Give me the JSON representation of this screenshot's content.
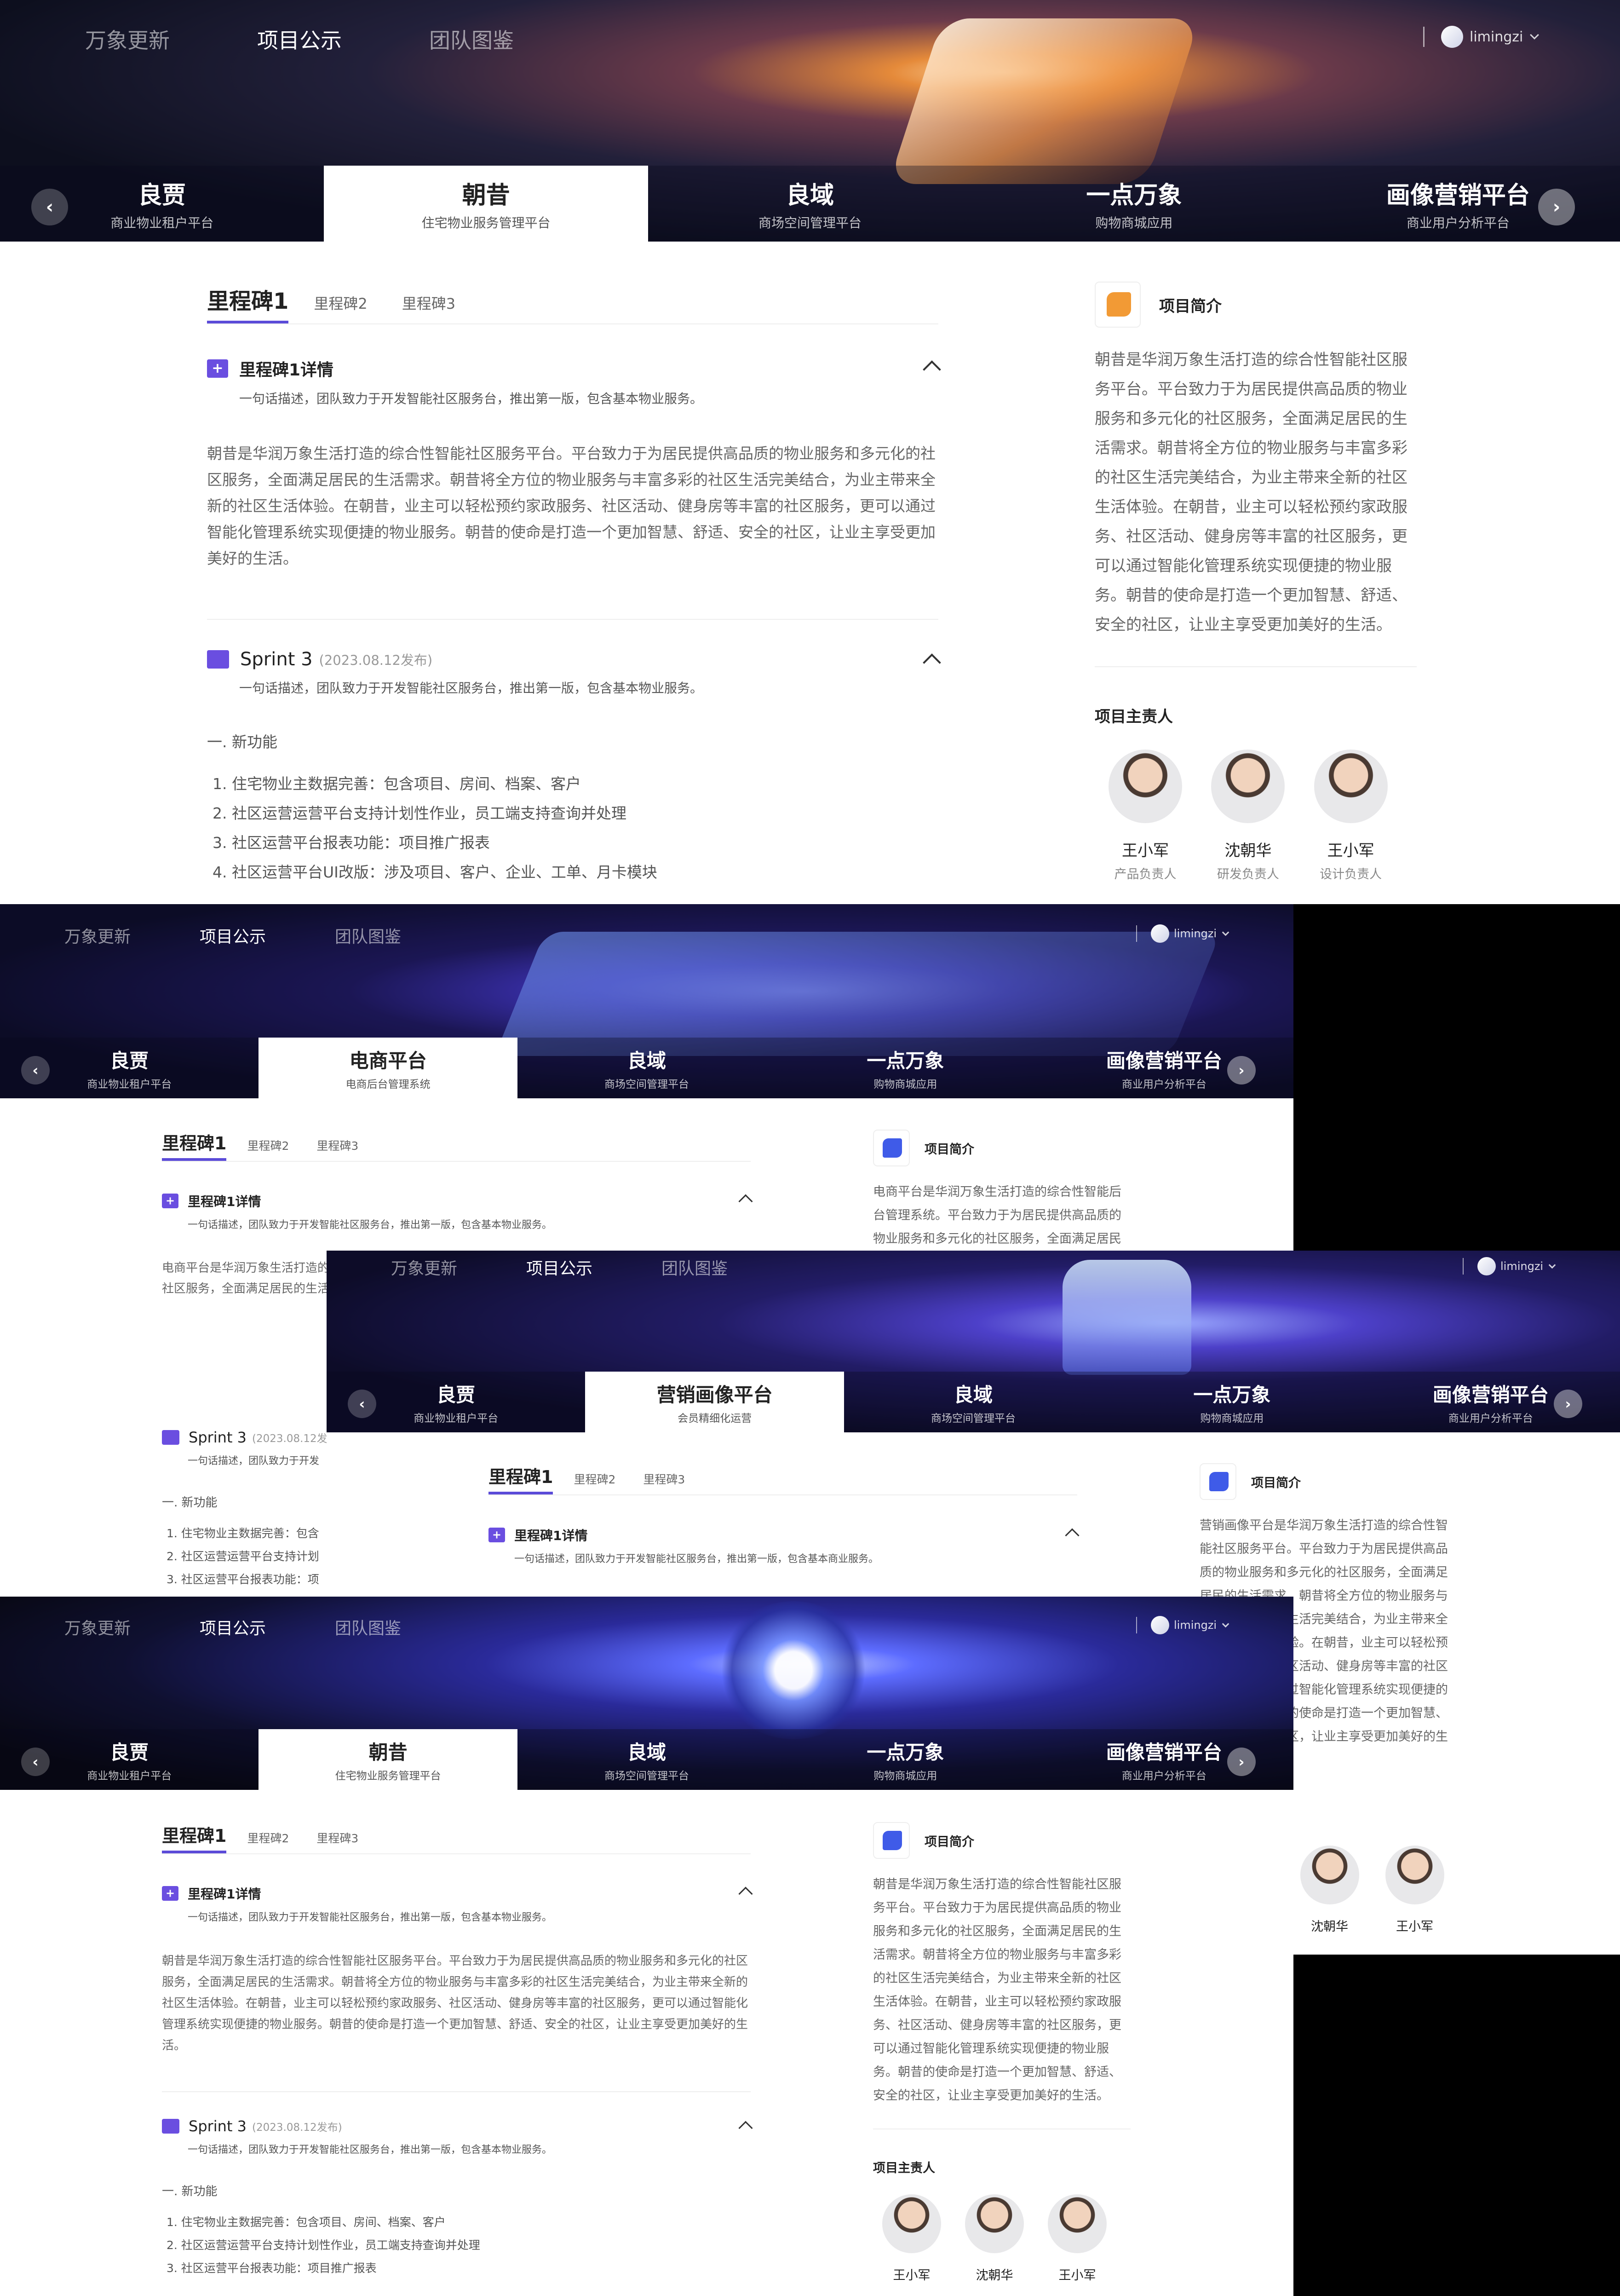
{
  "colors": {
    "accent": "#5b4bd8",
    "section_icon": "#6a4ee0",
    "logo_orange": "#f29a35",
    "logo_blue": "#3f5be8"
  },
  "header": {
    "nav": [
      "万象更新",
      "项目公示",
      "团队图鉴"
    ],
    "active_nav": "项目公示",
    "username": "limingzi",
    "prev_icon": "chevron-left-icon",
    "next_icon": "chevron-right-icon"
  },
  "shots": [
    {
      "tabs": [
        {
          "title": "良贾",
          "subtitle": "商业物业租户平台"
        },
        {
          "title": "朝昔",
          "subtitle": "住宅物业服务管理平台"
        },
        {
          "title": "良域",
          "subtitle": "商场空间管理平台"
        },
        {
          "title": "一点万象",
          "subtitle": "购物商城应用"
        },
        {
          "title": "画像营销平台",
          "subtitle": "商业用户分析平台"
        }
      ],
      "active_tab": "朝昔",
      "milestones": [
        "里程碑1",
        "里程碑2",
        "里程碑3"
      ],
      "detail": {
        "title": "里程碑1详情",
        "desc": "一句话描述，团队致力于开发智能社区服务台，推出第一版，包含基本物业服务。"
      },
      "body": "朝昔是华润万象生活打造的综合性智能社区服务平台。平台致力于为居民提供高品质的物业服务和多元化的社区服务，全面满足居民的生活需求。朝昔将全方位的物业服务与丰富多彩的社区生活完美结合，为业主带来全新的社区生活体验。在朝昔，业主可以轻松预约家政服务、社区活动、健身房等丰富的社区服务，更可以通过智能化管理系统实现便捷的物业服务。朝昔的使命是打造一个更加智慧、舒适、安全的社区，让业主享受更加美好的生活。",
      "sprint": {
        "name": "Sprint 3",
        "date": "(2023.08.12发布)",
        "desc": "一句话描述，团队致力于开发智能社区服务台，推出第一版，包含基本物业服务。"
      },
      "features_title": "一. 新功能",
      "features": [
        "1. 住宅物业主数据完善：包含项目、房间、档案、客户",
        "2. 社区运营运营平台支持计划性作业，员工端支持查询并处理",
        "3. 社区运营平台报表功能：项目推广报表",
        "4. 社区运营平台UI改版：涉及项目、客户、企业、工单、月卡模块"
      ],
      "intro_label": "项目简介",
      "intro": "朝昔是华润万象生活打造的综合性智能社区服务平台。平台致力于为居民提供高品质的物业服务和多元化的社区服务，全面满足居民的生活需求。朝昔将全方位的物业服务与丰富多彩的社区生活完美结合，为业主带来全新的社区生活体验。在朝昔，业主可以轻松预约家政服务、社区活动、健身房等丰富的社区服务，更可以通过智能化管理系统实现便捷的物业服务。朝昔的使命是打造一个更加智慧、舒适、安全的社区，让业主享受更加美好的生活。",
      "owners_label": "项目主责人",
      "owners": [
        {
          "name": "王小军",
          "role": "产品负责人"
        },
        {
          "name": "沈朝华",
          "role": "研发负责人"
        },
        {
          "name": "王小军",
          "role": "设计负责人"
        }
      ]
    },
    {
      "tabs": [
        {
          "title": "良贾",
          "subtitle": "商业物业租户平台"
        },
        {
          "title": "电商平台",
          "subtitle": "电商后台管理系统"
        },
        {
          "title": "良域",
          "subtitle": "商场空间管理平台"
        },
        {
          "title": "一点万象",
          "subtitle": "购物商城应用"
        },
        {
          "title": "画像营销平台",
          "subtitle": "商业用户分析平台"
        }
      ],
      "milestones": [
        "里程碑1",
        "里程碑2",
        "里程碑3"
      ],
      "detail": {
        "title": "里程碑1详情",
        "desc": "一句话描述，团队致力于开发智能社区服务台，推出第一版，包含基本物业服务。"
      },
      "body": "电商平台是华润万象生活打造的综合性智能社区服务平台。平台致力于为居民提供高品质的物业服务和多元化的社区服务，全面满足居民的生活需求。",
      "sprint": {
        "name": "Sprint 3",
        "date": "(2023.08.12发布)",
        "desc": "一句话描述，团队致力于开发"
      },
      "features_title": "一. 新功能",
      "features": [
        "1. 住宅物业主数据完善：包含",
        "2. 社区运营运营平台支持计划",
        "3. 社区运营平台报表功能：项"
      ],
      "intro_label": "项目简介",
      "intro": "电商平台是华润万象生活打造的综合性智能后台管理系统。平台致力于为居民提供高品质的物业服务和多元化的社区服务，全面满足居民"
    },
    {
      "tabs": [
        {
          "title": "良贾",
          "subtitle": "商业物业租户平台"
        },
        {
          "title": "营销画像平台",
          "subtitle": "会员精细化运营"
        },
        {
          "title": "良域",
          "subtitle": "商场空间管理平台"
        },
        {
          "title": "一点万象",
          "subtitle": "购物商城应用"
        },
        {
          "title": "画像营销平台",
          "subtitle": "商业用户分析平台"
        }
      ],
      "milestones": [
        "里程碑1",
        "里程碑2",
        "里程碑3"
      ],
      "detail": {
        "title": "里程碑1详情",
        "desc": "一句话描述，团队致力于开发智能社区服务台，推出第一版，包含基本商业服务。"
      },
      "intro_label": "项目简介",
      "intro": "营销画像平台是华润万象生活打造的综合性智能社区服务平台。平台致力于为居民提供高品质的物业服务和多元化的社区服务，全面满足居民的生活需求。朝昔将全方位的物业服务与丰富多彩的社区生活完美结合，为业主带来全新的社区生活体验。在朝昔，业主可以轻松预约家政服务、社区活动、健身房等丰富的社区服务，更可以通过智能化管理系统实现便捷的物业服务。朝昔的使命是打造一个更加智慧、舒适、安全的社区，让业主享受更加美好的生活。",
      "owners": [
        {
          "name": "沈朝华"
        },
        {
          "name": "王小军"
        }
      ]
    },
    {
      "tabs": [
        {
          "title": "良贾",
          "subtitle": "商业物业租户平台"
        },
        {
          "title": "朝昔",
          "subtitle": "住宅物业服务管理平台"
        },
        {
          "title": "良域",
          "subtitle": "商场空间管理平台"
        },
        {
          "title": "一点万象",
          "subtitle": "购物商城应用"
        },
        {
          "title": "画像营销平台",
          "subtitle": "商业用户分析平台"
        }
      ],
      "milestones": [
        "里程碑1",
        "里程碑2",
        "里程碑3"
      ],
      "detail": {
        "title": "里程碑1详情",
        "desc": "一句话描述，团队致力于开发智能社区服务台，推出第一版，包含基本物业服务。"
      },
      "body": "朝昔是华润万象生活打造的综合性智能社区服务平台。平台致力于为居民提供高品质的物业服务和多元化的社区服务，全面满足居民的生活需求。朝昔将全方位的物业服务与丰富多彩的社区生活完美结合，为业主带来全新的社区生活体验。在朝昔，业主可以轻松预约家政服务、社区活动、健身房等丰富的社区服务，更可以通过智能化管理系统实现便捷的物业服务。朝昔的使命是打造一个更加智慧、舒适、安全的社区，让业主享受更加美好的生活。",
      "sprint": {
        "name": "Sprint 3",
        "date": "(2023.08.12发布)",
        "desc": "一句话描述，团队致力于开发智能社区服务台，推出第一版，包含基本物业服务。"
      },
      "features_title": "一. 新功能",
      "features": [
        "1. 住宅物业主数据完善：包含项目、房间、档案、客户",
        "2. 社区运营运营平台支持计划性作业，员工端支持查询并处理",
        "3. 社区运营平台报表功能：项目推广报表"
      ],
      "intro_label": "项目简介",
      "intro": "朝昔是华润万象生活打造的综合性智能社区服务平台。平台致力于为居民提供高品质的物业服务和多元化的社区服务，全面满足居民的生活需求。朝昔将全方位的物业服务与丰富多彩的社区生活完美结合，为业主带来全新的社区生活体验。在朝昔，业主可以轻松预约家政服务、社区活动、健身房等丰富的社区服务，更可以通过智能化管理系统实现便捷的物业服务。朝昔的使命是打造一个更加智慧、舒适、安全的社区，让业主享受更加美好的生活。",
      "owners_label": "项目主责人",
      "owners": [
        {
          "name": "王小军"
        },
        {
          "name": "沈朝华"
        },
        {
          "name": "王小军"
        }
      ]
    }
  ]
}
